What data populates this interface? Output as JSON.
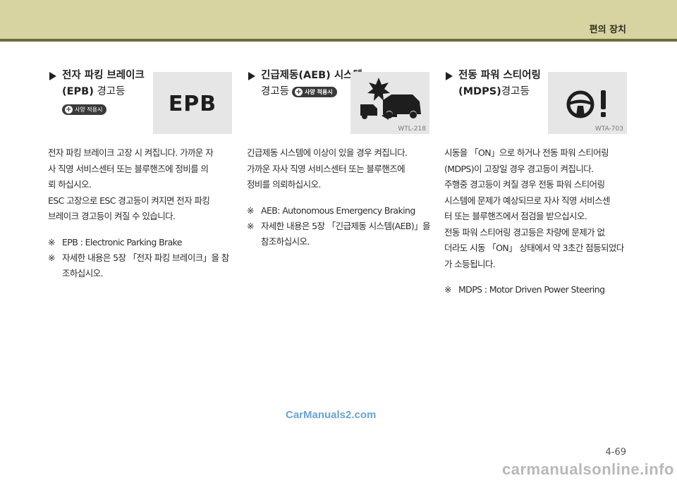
{
  "header": {
    "title": "편의 장치"
  },
  "sections": [
    {
      "title_line1": "전자 파킹 브레이크",
      "title_line2_bold": "(EPB)",
      "title_line2_rest": " 경고등",
      "badge": "사양 적용시",
      "icon": {
        "name": "epb-warning-icon",
        "text": "EPB"
      },
      "body": [
        "전자 파킹 브레이크 고장 시 켜집니다. 가까운 자",
        "사 직영 서비스센터 또는 블루핸즈에 정비를 의",
        "뢰 하십시오.",
        "ESC 고장으로 ESC 경고등이 켜지면 전자 파킹",
        "브레이크 경고등이 켜질 수 있습니다."
      ],
      "notes": [
        {
          "mark": "※",
          "lines": [
            "EPB :  Electronic Parking Brake"
          ]
        },
        {
          "mark": "※",
          "lines": [
            "자세한 내용은 5장 「전자 파킹 브레이크」을 참",
            "조하십시오."
          ]
        }
      ]
    },
    {
      "title_line1": "긴급제동(AEB) 시스템",
      "title_line2_rest": "경고등",
      "badge": "사양 적용시",
      "icon": {
        "name": "aeb-warning-icon",
        "code": "WTL-218"
      },
      "body": [
        "긴급제동 시스템에 이상이 있을 경우 켜집니다.",
        "가까운 자사 직영 서비스센터 또는 블루핸즈에",
        "정비를 의뢰하십시오."
      ],
      "notes": [
        {
          "mark": "※",
          "lines": [
            "AEB: Autonomous Emergency Braking"
          ]
        },
        {
          "mark": "※",
          "lines": [
            "자세한 내용은 5장 「긴급제동 시스템(AEB)」을",
            "참조하십시오."
          ]
        }
      ]
    },
    {
      "title_line1": "전동 파워 스티어링",
      "title_line2_bold": "(MDPS)",
      "title_line2_rest": "경고등",
      "icon": {
        "name": "mdps-warning-icon",
        "code": "WTA-703"
      },
      "body": [
        "시동을 「ON」으로 하거나 전동 파워 스티어링",
        "(MDPS)이 고장일 경우 경고등이 켜집니다.",
        "주행중 경고등이 켜질 경우 전동 파워 스티어링",
        "시스템에 문제가 예상되므로 자사 직영 서비스센",
        "터 또는 블루핸즈에서 점검을 받으십시오.",
        "전동 파워 스티어링 경고등은 차량에 문제가 없",
        "더라도 시동 「ON」 상태에서 약 3초간 점등되었다",
        "가 소등됩니다."
      ],
      "notes": [
        {
          "mark": "※",
          "lines": [
            "MDPS :  Motor Driven Power Steering"
          ]
        }
      ]
    }
  ],
  "watermark": "CarManuals2.com",
  "page_number": "4-69",
  "footer_watermark": "carmanualsonline.info"
}
